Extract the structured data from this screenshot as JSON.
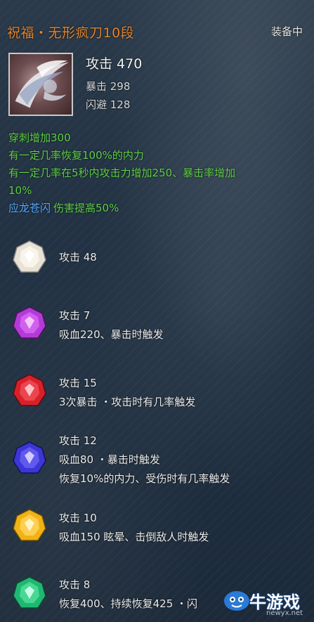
{
  "item": {
    "name": "祝福・无形疯刀10段",
    "status": "装备中",
    "icon": "blade-weapon-icon",
    "attack": "攻击 470",
    "crit": "暴击 298",
    "evade": "闪避 128"
  },
  "effects": [
    "穿刺增加300",
    "有一定几率恢复100%的内力",
    "有一定几率在5秒内攻击力增加250、暴击率增加",
    "10%"
  ],
  "special": {
    "name": "应龙苍闪",
    "desc": "伤害提高50%"
  },
  "gems": [
    {
      "color": "white",
      "hex": "#e8e2d6",
      "lines": [
        "攻击 48"
      ]
    },
    {
      "color": "purple",
      "hex": "#b43ad8",
      "lines": [
        "攻击 7",
        "吸血220、暴击时触发"
      ]
    },
    {
      "color": "red",
      "hex": "#d8202a",
      "lines": [
        "攻击 15",
        "3次暴击 ・攻击时有几率触发"
      ]
    },
    {
      "color": "blue",
      "hex": "#3d36d6",
      "lines": [
        "攻击 12",
        "吸血80 ・暴击时触发",
        "恢复10%的内力、受伤时有几率触发"
      ]
    },
    {
      "color": "yellow",
      "hex": "#f0b214",
      "lines": [
        "攻击 10",
        "吸血150 眩晕、击倒敌人时触发"
      ]
    },
    {
      "color": "green",
      "hex": "#1fb872",
      "lines": [
        "攻击 8",
        "恢复400、持续恢复425 ・闪"
      ]
    }
  ],
  "watermark": {
    "text": "牛游戏",
    "url": "newyx.net"
  }
}
